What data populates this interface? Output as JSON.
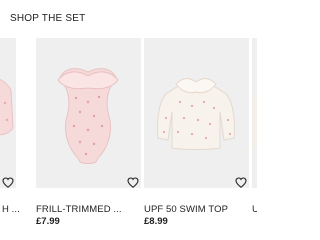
{
  "section": {
    "title": "SHOP THE SET"
  },
  "products": [
    {
      "name": "... H ...",
      "price": "",
      "image": "pink-garment-partial",
      "wishlist_icon": "heart-outline-icon"
    },
    {
      "name": "FRILL-TRIMMED ...",
      "price": "£7.99",
      "image": "pink-frill-swimsuit",
      "wishlist_icon": "heart-outline-icon"
    },
    {
      "name": "UPF 50 SWIM TOP",
      "price": "£8.99",
      "image": "cream-dotted-swim-top",
      "wishlist_icon": "heart-outline-icon"
    },
    {
      "name": "U",
      "price": "",
      "image": "partial-item",
      "wishlist_icon": "heart-outline-icon"
    }
  ],
  "colors": {
    "tile_bg": "#efefef",
    "text": "#222222",
    "pink_fabric": "#f6d9d9",
    "cream_fabric": "#f7f2ec"
  }
}
